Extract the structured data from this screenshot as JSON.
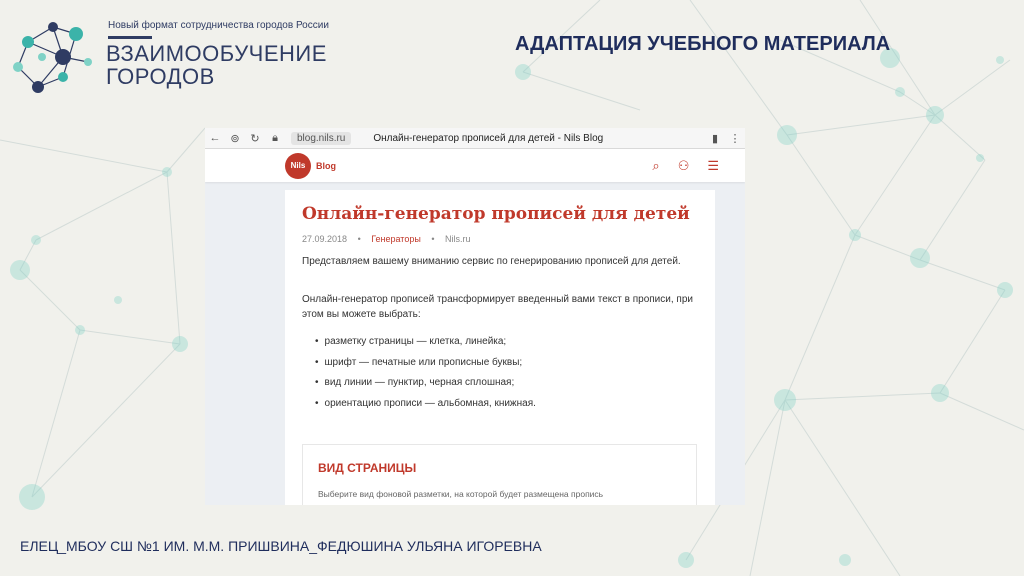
{
  "header": {
    "org_tagline": "Новый формат сотрудничества городов России",
    "org_name_line1": "ВЗАИМООБУЧЕНИЕ",
    "org_name_line2": "ГОРОДОВ",
    "slide_title": "АДАПТАЦИЯ УЧЕБНОГО МАТЕРИАЛА"
  },
  "browser": {
    "url": "blog.nils.ru",
    "tab_title": "Онлайн-генератор прописей для детей - Nils Blog",
    "icons": [
      "back-arrow-icon",
      "shield-icon",
      "refresh-icon",
      "lock-icon",
      "bookmark-icon",
      "menu-dots-icon"
    ]
  },
  "site": {
    "logo_text": "Nils",
    "blog_label": "Blog",
    "icons": [
      "search-icon",
      "user-icon",
      "hamburger-icon"
    ]
  },
  "article": {
    "title": "Онлайн-генератор прописей для детей",
    "date": "27.09.2018",
    "category": "Генераторы",
    "author": "Nils.ru",
    "paragraph1": "Представляем вашему вниманию сервис по генерированию прописей для детей.",
    "paragraph2": "Онлайн-генератор прописей трансформирует введенный вами текст в прописи, при этом вы можете выбрать:",
    "bullets": [
      "разметку страницы — клетка, линейка;",
      "шрифт — печатные или прописные буквы;",
      "вид линии — пунктир, черная сплошная;",
      "ориентацию прописи — альбомная, книжная."
    ],
    "section_title": "ВИД СТРАНИЦЫ",
    "section_desc": "Выберите вид фоновой разметки, на которой будет размещена пропись"
  },
  "footer": {
    "text": "ЕЛЕЦ_МБОУ СШ №1 ИМ. М.М. ПРИШВИНА_ФЕДЮШИНА УЛЬЯНА ИГОРЕВНА"
  },
  "colors": {
    "background": "#f1f1ec",
    "navy": "#1f2d5c",
    "accent_red": "#c0392b",
    "network_teal": "#7fd2c6"
  }
}
